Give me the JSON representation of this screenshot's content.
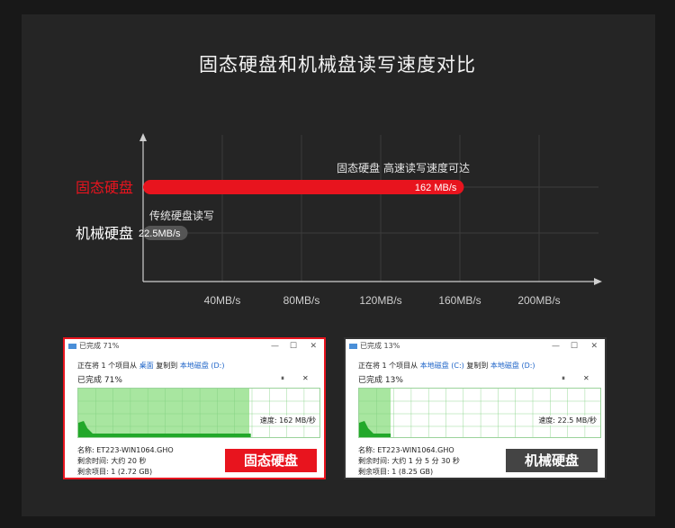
{
  "title": "固态硬盘和机械盘读写速度对比",
  "chart_data": {
    "type": "bar",
    "categories": [
      "固态硬盘",
      "机械硬盘"
    ],
    "values": [
      162,
      22.5
    ],
    "value_labels": [
      "162 MB/s",
      "22.5MB/s"
    ],
    "annotations": [
      "固态硬盘 高速读写速度可达",
      "传统硬盘读写"
    ],
    "xticks": [
      "40MB/s",
      "80MB/s",
      "120MB/s",
      "160MB/s",
      "200MB/s"
    ],
    "xtick_values": [
      40,
      80,
      120,
      160,
      200
    ],
    "xlim": [
      0,
      230
    ],
    "colors": {
      "ssd": "#e8141e",
      "hdd": "#555555",
      "label_ssd": "#e8141e",
      "label_hdd": "#ffffff"
    },
    "grid": true
  },
  "ssd_window": {
    "title": "已完成 71%",
    "line1_prefix": "正在将 1 个项目从",
    "line1_src": "桌面",
    "line1_mid": "复制到",
    "line1_dst": "本地磁盘 (D:)",
    "progress_text": "已完成 71%",
    "progress": 0.71,
    "speed": "速度: 162 MB/秒",
    "name": "名称: ET223-WIN1064.GHO",
    "time_left": "剩余时间: 大约 20 秒",
    "items_left": "剩余项目: 1 (2.72 GB)",
    "tag": "固态硬盘",
    "tag_color": "#e8141e"
  },
  "hdd_window": {
    "title": "已完成 13%",
    "line1_prefix": "正在将 1 个项目从",
    "line1_src": "本地磁盘 (C:)",
    "line1_mid": "复制到",
    "line1_dst": "本地磁盘 (D:)",
    "progress_text": "已完成 13%",
    "progress": 0.13,
    "speed": "速度: 22.5 MB/秒",
    "name": "名称: ET223-WIN1064.GHO",
    "time_left": "剩余时间: 大约 1 分 5 分 30 秒",
    "items_left": "剩余项目: 1 (8.25 GB)",
    "tag": "机械硬盘",
    "tag_color": "#444444"
  },
  "window_controls": {
    "minimize": "—",
    "maximize": "☐",
    "close": "✕",
    "pause": "⏸",
    "stop": "✕"
  }
}
